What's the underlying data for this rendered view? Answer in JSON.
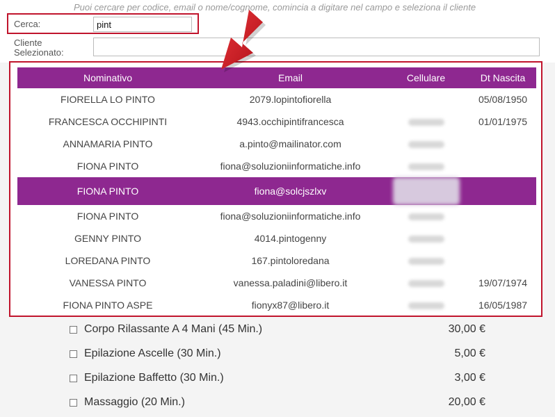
{
  "search": {
    "hint": "Puoi cercare per codice, email o nome/cognome, comincia a digitare nel campo e seleziona il cliente",
    "cerca_label": "Cerca:",
    "cerca_value": "pint",
    "cliente_label_line1": "Cliente",
    "cliente_label_line2": "Selezionato:",
    "cliente_value": ""
  },
  "results": {
    "headers": [
      "Nominativo",
      "Email",
      "Cellulare",
      "Dt Nascita"
    ],
    "rows": [
      {
        "name": "FIORELLA LO PINTO",
        "email": "2079.lopintofiorella",
        "phone_hidden": false,
        "dob": "05/08/1950"
      },
      {
        "name": "FRANCESCA OCCHIPINTI",
        "email": "4943.occhipintifrancesca",
        "phone_hidden": true,
        "dob": "01/01/1975"
      },
      {
        "name": "ANNAMARIA PINTO",
        "email": "a.pinto@mailinator.com",
        "phone_hidden": true,
        "dob": ""
      },
      {
        "name": "FIONA PINTO",
        "email": "fiona@soluzioniinformatiche.info",
        "phone_hidden": true,
        "dob": ""
      },
      {
        "name": "FIONA PINTO",
        "email": "fiona@solcjszlxv",
        "phone_hidden": true,
        "dob": "",
        "selected": true
      },
      {
        "name": "FIONA PINTO",
        "email": "fiona@soluzioniinformatiche.info",
        "phone_hidden": true,
        "dob": ""
      },
      {
        "name": "GENNY PINTO",
        "email": "4014.pintogenny",
        "phone_hidden": true,
        "dob": ""
      },
      {
        "name": "LOREDANA PINTO",
        "email": "167.pintoloredana",
        "phone_hidden": true,
        "dob": ""
      },
      {
        "name": "VANESSA PINTO",
        "email": "vanessa.paladini@libero.it",
        "phone_hidden": true,
        "dob": "19/07/1974"
      },
      {
        "name": "FIONA PINTO ASPE",
        "email": "fionyx87@libero.it",
        "phone_hidden": true,
        "dob": "16/05/1987"
      }
    ]
  },
  "services": [
    {
      "label": "Corpo Rilassante A 4 Mani (45 Min.)",
      "price": "30,00 €"
    },
    {
      "label": "Epilazione Ascelle (30 Min.)",
      "price": "5,00 €"
    },
    {
      "label": "Epilazione Baffetto (30 Min.)",
      "price": "3,00 €"
    },
    {
      "label": "Massaggio (20 Min.)",
      "price": "20,00 €"
    }
  ],
  "colors": {
    "header_bg": "#8e2890",
    "highlight_border": "#c0142c",
    "arrow": "#d41a1a"
  }
}
